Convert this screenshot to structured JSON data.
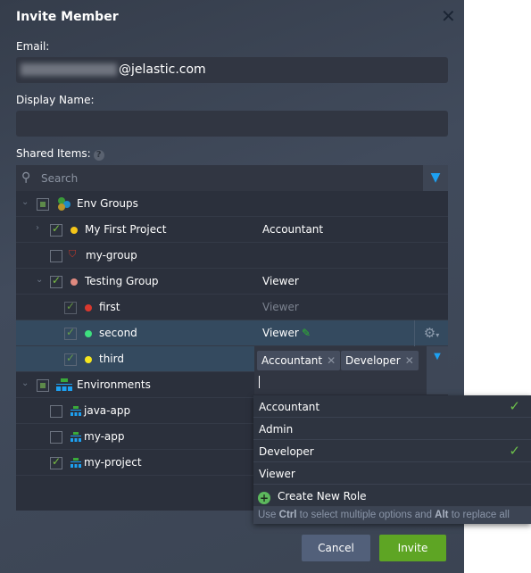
{
  "dialog": {
    "title": "Invite Member",
    "close_icon": "close-icon"
  },
  "email": {
    "label": "Email:",
    "value_suffix": "@jelastic.com"
  },
  "display_name": {
    "label": "Display Name:",
    "value": ""
  },
  "shared_items": {
    "label": "Shared Items:",
    "help": "?",
    "search_placeholder": "Search"
  },
  "tree": {
    "env_groups": {
      "label": "Env Groups",
      "items": [
        {
          "name": "My First Project",
          "role": "Accountant",
          "color": "#f5c518",
          "checked": true
        },
        {
          "name": "my-group",
          "role": "",
          "checked": false
        },
        {
          "name": "Testing Group",
          "role": "Viewer",
          "color": "#e08a80",
          "checked": true
        },
        {
          "name": "first",
          "role": "Viewer",
          "color": "#d9382e",
          "checked": true
        },
        {
          "name": "second",
          "role": "Viewer",
          "color": "#3ee07f",
          "checked": true
        },
        {
          "name": "third",
          "color": "#f5e61f",
          "checked": true,
          "roles": [
            "Accountant",
            "Developer"
          ]
        }
      ]
    },
    "environments": {
      "label": "Environments",
      "items": [
        {
          "name": "java-app",
          "checked": false
        },
        {
          "name": "my-app",
          "checked": false
        },
        {
          "name": "my-project",
          "checked": true
        }
      ]
    }
  },
  "dropdown": {
    "options": [
      {
        "label": "Accountant",
        "selected": true
      },
      {
        "label": "Admin",
        "selected": false
      },
      {
        "label": "Developer",
        "selected": true
      },
      {
        "label": "Viewer",
        "selected": false
      }
    ],
    "create_label": "Create New Role",
    "hint": {
      "p1": "Use ",
      "k1": "Ctrl",
      "p2": " to select multiple options and ",
      "k2": "Alt",
      "p3": " to replace all"
    }
  },
  "buttons": {
    "cancel": "Cancel",
    "invite": "Invite"
  },
  "colors": {
    "accent": "#1da1f2",
    "invite": "#5ea524",
    "cancel": "#52607a"
  }
}
